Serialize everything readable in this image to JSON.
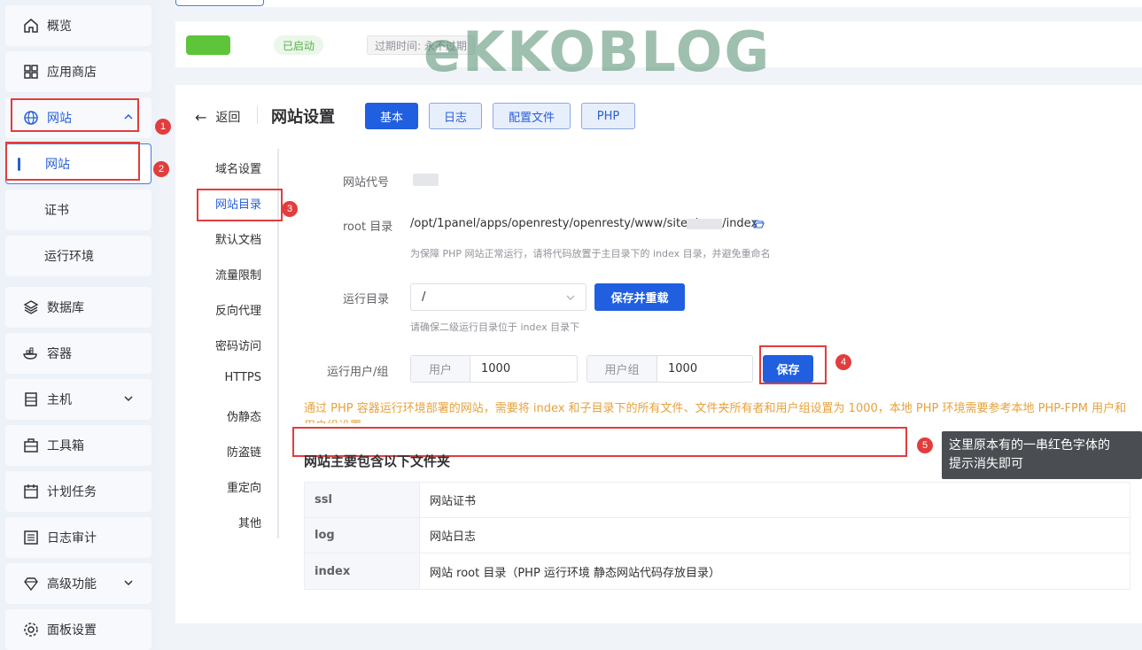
{
  "sidebar": {
    "items": [
      {
        "label": "概览",
        "icon": "home-icon"
      },
      {
        "label": "应用商店",
        "icon": "apps-grid-icon"
      },
      {
        "label": "网站",
        "icon": "globe-icon"
      },
      {
        "label": "网站"
      },
      {
        "label": "证书"
      },
      {
        "label": "运行环境"
      },
      {
        "label": "数据库",
        "icon": "layers-icon"
      },
      {
        "label": "容器",
        "icon": "docker-icon"
      },
      {
        "label": "主机",
        "icon": "server-icon"
      },
      {
        "label": "工具箱",
        "icon": "toolbox-icon"
      },
      {
        "label": "计划任务",
        "icon": "calendar-icon"
      },
      {
        "label": "日志审计",
        "icon": "log-list-icon"
      },
      {
        "label": "高级功能",
        "icon": "diamond-icon"
      },
      {
        "label": "面板设置",
        "icon": "gear-icon"
      }
    ]
  },
  "header": {
    "status": "已启动",
    "expire": "过期时间: 永不过期",
    "watermark": "eKKOBLOG"
  },
  "main": {
    "back_label": "返回",
    "title": "网站设置",
    "tabs": [
      {
        "label": "基本"
      },
      {
        "label": "日志"
      },
      {
        "label": "配置文件"
      },
      {
        "label": "PHP"
      }
    ],
    "nav": [
      "域名设置",
      "网站目录",
      "默认文档",
      "流量限制",
      "反向代理",
      "密码访问",
      "HTTPS",
      "伪静态",
      "防盗链",
      "重定向",
      "其他"
    ],
    "form": {
      "site_code_label": "网站代号",
      "root_label": "root 目录",
      "root_prefix": "/opt/1panel/apps/openresty/openresty/www/sites/",
      "root_suffix": "/index",
      "root_hint": "为保障 PHP 网站正常运行，请将代码放置于主目录下的 index 目录，并避免重命名",
      "run_dir_label": "运行目录",
      "run_dir_value": "/",
      "save_reload_label": "保存并重载",
      "run_dir_hint": "请确保二级运行目录位于 index 目录下",
      "run_user_label": "运行用户/组",
      "user_prepend": "用户",
      "user_value": "1000",
      "group_prepend": "用户组",
      "group_value": "1000",
      "save_label": "保存"
    },
    "warning": "通过 PHP 容器运行环境部署的网站，需要将 index 和子目录下的所有文件、文件夹所有者和用户组设置为 1000，本地 PHP 环境需要参考本地 PHP-FPM 用户和用户组设置",
    "section_title": "网站主要包含以下文件夹",
    "table": [
      {
        "k": "ssl",
        "v": "网站证书"
      },
      {
        "k": "log",
        "v": "网站日志"
      },
      {
        "k": "index",
        "v": "网站 root 目录（PHP 运行环境 静态网站代码存放目录）"
      }
    ]
  },
  "annotations": {
    "n1": "1",
    "n2": "2",
    "n3": "3",
    "n4": "4",
    "n5": "5",
    "tooltip_line1": "这里原本有的一串红色字体的",
    "tooltip_line2": "提示消失即可"
  },
  "colors": {
    "accent": "#1f5fe0",
    "annotation": "#e23d3d",
    "warning": "#e6a23c"
  }
}
